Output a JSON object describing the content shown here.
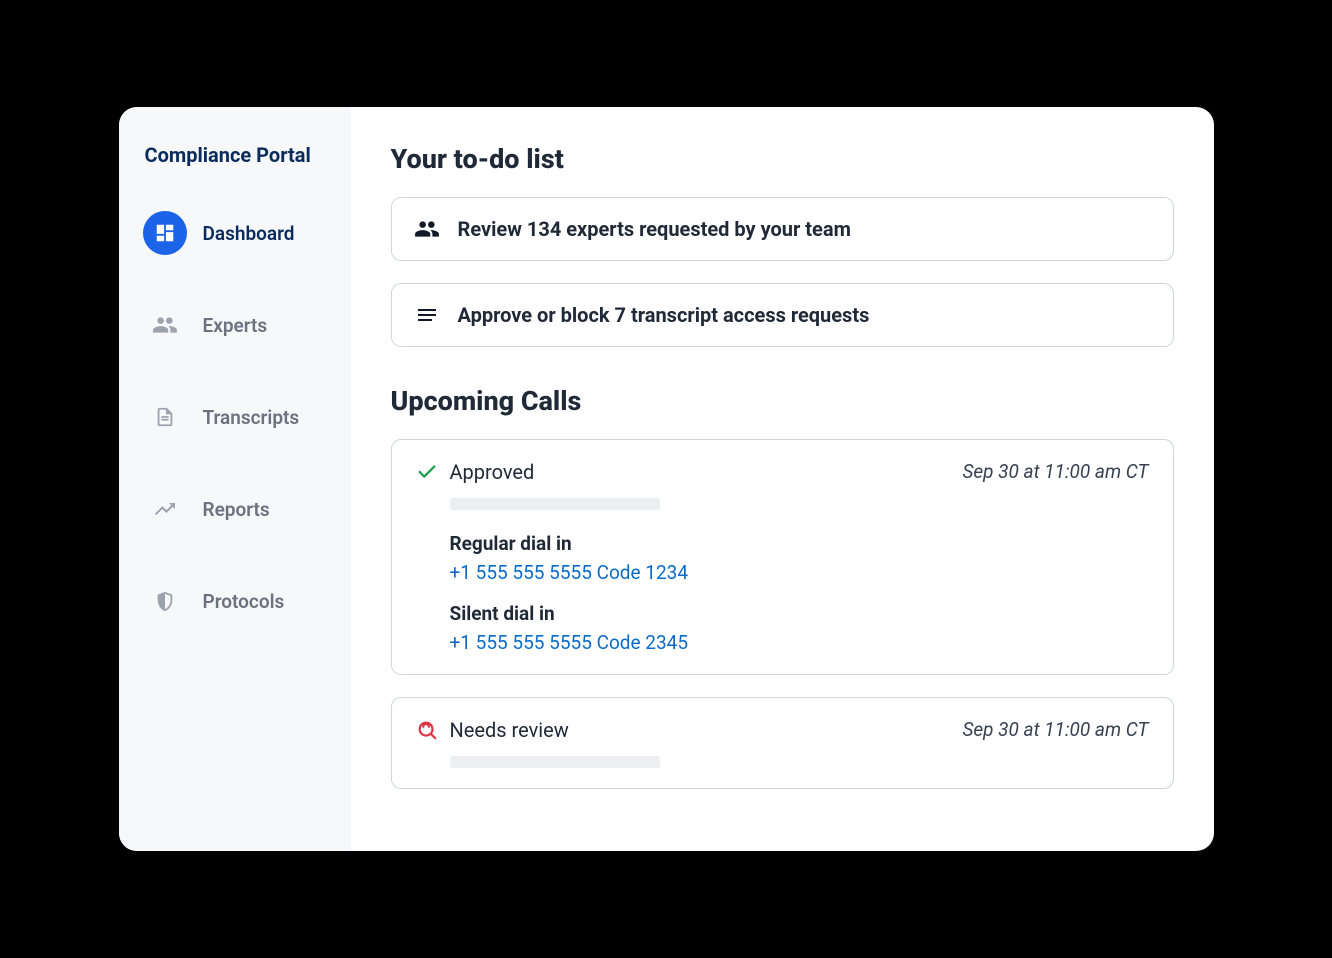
{
  "sidebar": {
    "title": "Compliance Portal",
    "items": [
      {
        "label": "Dashboard"
      },
      {
        "label": "Experts"
      },
      {
        "label": "Transcripts"
      },
      {
        "label": "Reports"
      },
      {
        "label": "Protocols"
      }
    ]
  },
  "main": {
    "todo": {
      "heading": "Your to-do list",
      "items": [
        {
          "text": "Review 134 experts requested by your team"
        },
        {
          "text": "Approve or block 7 transcript access requests"
        }
      ]
    },
    "upcoming": {
      "heading": "Upcoming Calls",
      "calls": [
        {
          "status": "Approved",
          "time": "Sep 30 at 11:00 am CT",
          "regular_label": "Regular dial in",
          "regular_value": "+1 555 555 5555 Code 1234",
          "silent_label": "Silent dial in",
          "silent_value": "+1 555 555 5555 Code 2345"
        },
        {
          "status": "Needs review",
          "time": "Sep 30 at 11:00 am CT"
        }
      ]
    }
  }
}
